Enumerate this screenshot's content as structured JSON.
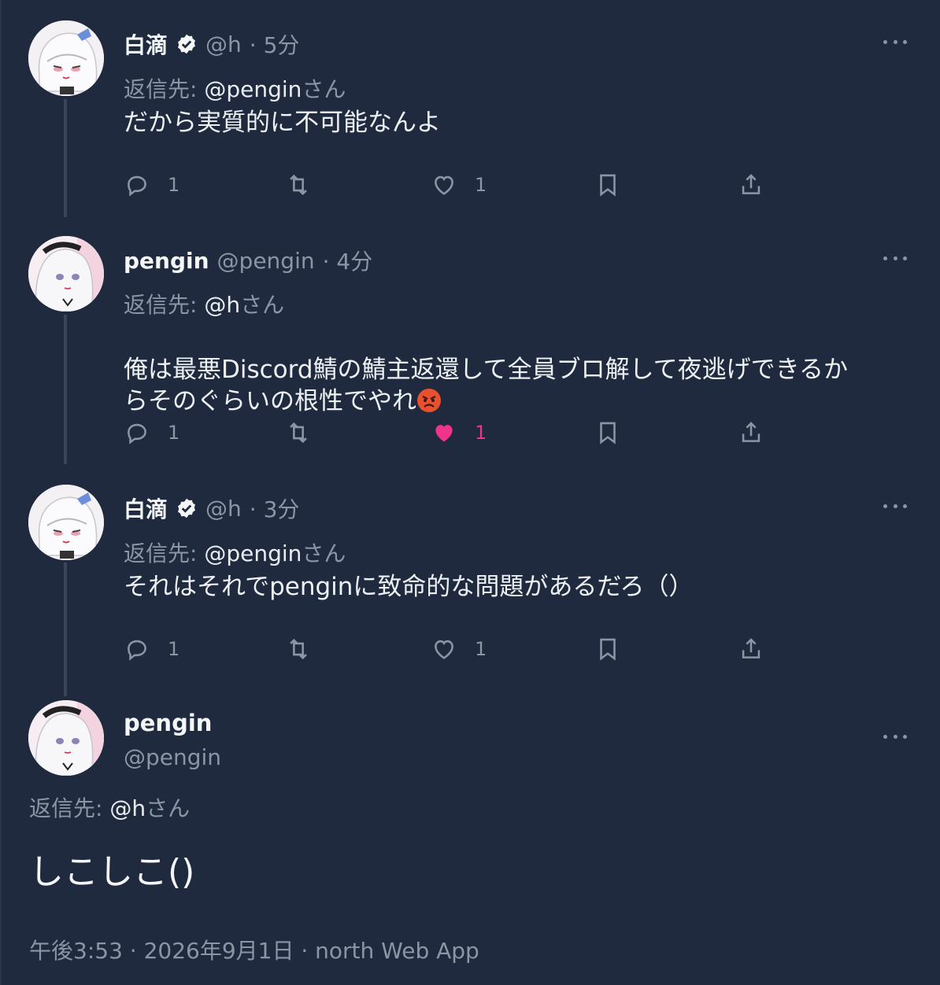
{
  "tweets": [
    {
      "name": "白滴",
      "handle": "@h",
      "time": "· 5分",
      "reply_label": "返信先:",
      "reply_handle": "@pengin",
      "reply_suffix": "さん",
      "text": "だから実質的に不可能なんよ",
      "reply_count": "1",
      "like_count": "1"
    },
    {
      "name": "pengin",
      "handle": "@pengin",
      "time": "· 4分",
      "reply_label": "返信先:",
      "reply_handle": "@h",
      "reply_suffix": "さん",
      "text": "俺は最悪Discord鯖の鯖主返還して全員ブロ解して夜逃げできるか\nらそのぐらいの根性でやれ",
      "reply_count": "1",
      "like_count": "1"
    },
    {
      "name": "白滴",
      "handle": "@h",
      "time": "· 3分",
      "reply_label": "返信先:",
      "reply_handle": "@pengin",
      "reply_suffix": "さん",
      "text": "それはそれでpenginに致命的な問題があるだろ（）",
      "reply_count": "1",
      "like_count": "1"
    }
  ],
  "main": {
    "name": "pengin",
    "handle": "@pengin",
    "reply_label": "返信先:",
    "reply_handle": "@h",
    "reply_suffix": "さん",
    "text": "しこしこ()",
    "timestamp": "午後3:53 · 2026年9月1日 · north Web App"
  },
  "colors": {
    "background": "#1f2a3e",
    "like_active": "#f0348a",
    "muted": "#8b96a5"
  },
  "icons": [
    "reply-icon",
    "retweet-icon",
    "heart-icon",
    "bookmark-icon",
    "share-icon",
    "more-icon",
    "verified-icon",
    "angry-face-emoji"
  ]
}
